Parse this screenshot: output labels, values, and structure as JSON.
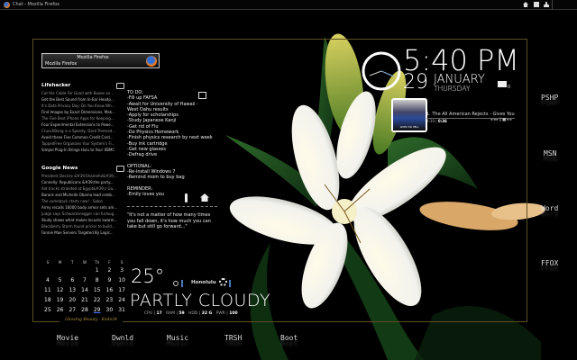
{
  "window": {
    "title": "Chat - Mozilla Firefox"
  },
  "taskbox": {
    "title": "Mozilla Firefox",
    "subtitle": "Mozilla Firefox"
  },
  "lifehacker": {
    "title": "Lifehacker",
    "items": [
      "Cut the Cable For Good with Boxee an...",
      "Get the Best Sound from In-Ear Headp...",
      "It's Data Privacy Day: Do You Know Wh...",
      "Find Images by Exact Dimensions, Mak...",
      "The Five Best iPhone Apps for Keeping...",
      "Four Experimental Extensions to Powe...",
      "CrunchBang is a Speedy, Dark-Themed...",
      "Avoid these Five Common Credit Card...",
      "TappedFree Organizes Your System's Fi...",
      "Simple Plug-In Brings Hulu to Your XBMC"
    ]
  },
  "google_news": {
    "title": "Google News",
    "items": [
      "President Decries &#39;Shameful&#39;...",
      "Connelly: Republicans &#39;the party...",
      "Aid trucks stranded at Egypt&#39;s Ga...",
      "Barack and Michelle Obama lead celeb...",
      "The comeback starts now! - Salon",
      "Army recalls 16000 body armor sets am...",
      "Judge says Schwarzenegger can furloug...",
      "Study shows what makes locusts swarm...",
      "Blackberry Storm found pricier to build...",
      "Fannie Mae Servers Targeted By Logic..."
    ]
  },
  "todo": {
    "text": "TO DO:\n-Fill up FAFSA\n-Await for University of Hawaii -\nWest Oahu results\n-Apply for scholarships\n-Study Japanese Kanji\n-Get rid of Flu\n-Do Physics Homework\n-Finish physics research by next week\n-Buy ink cartridge\n-Get new glasses\n-Defrag drive\n\nOPTIONAL:\n-Re-install Windows 7\n-Remind mom to buy bag\n\nREMINDER:\n-Emily loves you"
  },
  "quote": "\"It's not a matter of how many times you fall down, it's how much you can take but still go forward...\"",
  "calendar": {
    "headers": [
      "S",
      "M",
      "T",
      "W",
      "Th",
      "F",
      "S"
    ],
    "weeks": [
      [
        "",
        "",
        "",
        "",
        "1",
        "2",
        "3"
      ],
      [
        "4",
        "5",
        "6",
        "7",
        "8",
        "9",
        "10"
      ],
      [
        "11",
        "12",
        "13",
        "14",
        "15",
        "16",
        "17"
      ],
      [
        "18",
        "19",
        "20",
        "21",
        "22",
        "23",
        "24"
      ],
      [
        "25",
        "26",
        "27",
        "28",
        "29",
        "30",
        "31"
      ]
    ],
    "today": "29"
  },
  "theme_credit": "Glowing Beauty - Kodo34",
  "weather": {
    "temp": "25°",
    "location": "Honolulu",
    "condition": "PARTLY CLOUDY"
  },
  "stats": {
    "cpu_label": "CPU",
    "cpu": "17",
    "ram_label": "RAM",
    "ram": "59",
    "hdd_label": "HDD",
    "hdd": "32 G",
    "pwr_label": "PWR",
    "pwr": "100"
  },
  "clock": {
    "time": "5:40 PM",
    "day": "29",
    "month": "JANUARY",
    "weekday": "THURSDAY",
    "mail_count": "0"
  },
  "music": {
    "track": "1. The All American Rejects - Gives You",
    "elapsed": "3:30",
    "total": "0:36",
    "album_text": "GIVES YOU HELL"
  },
  "right_shortcuts": [
    "PSHP",
    "MSN",
    "Word",
    "FFOX"
  ],
  "bottom_shortcuts": [
    "Movie",
    "Dwnld",
    "Music",
    "TRSH",
    "Boot"
  ]
}
